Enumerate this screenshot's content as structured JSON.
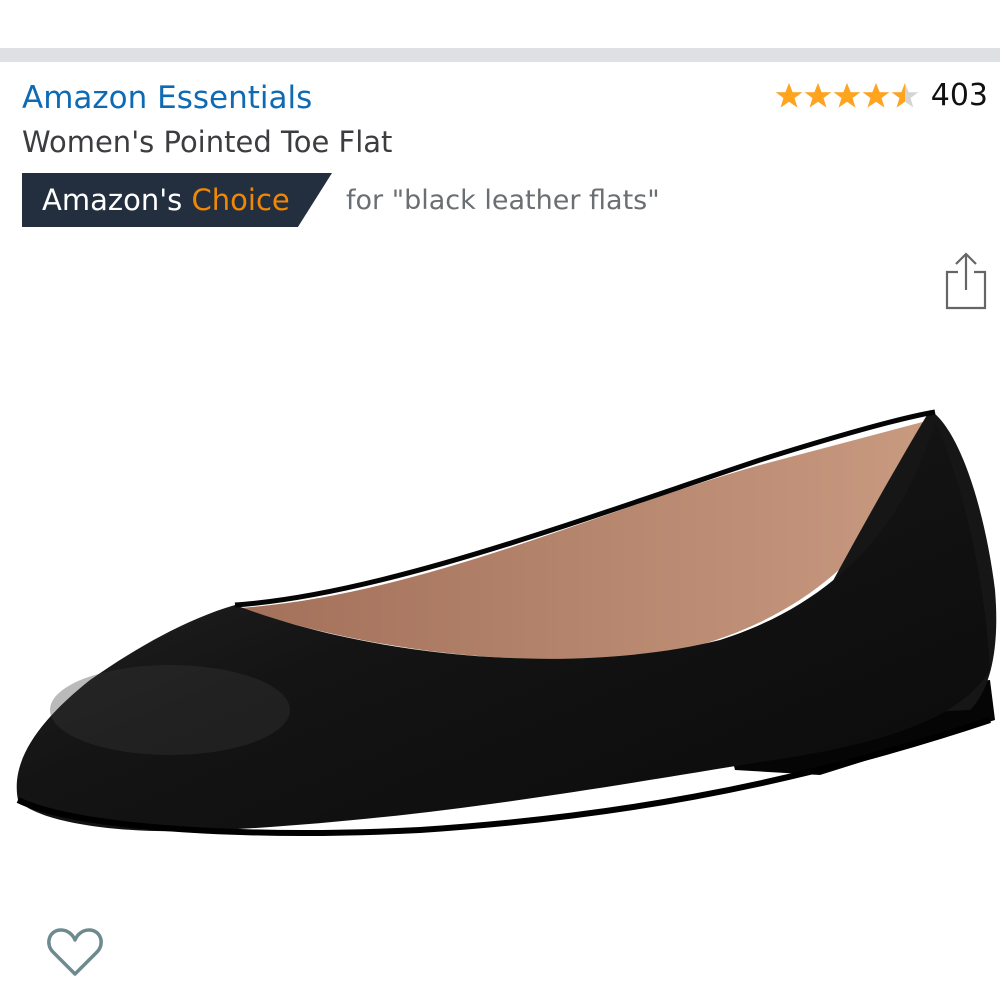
{
  "product": {
    "brand": "Amazon Essentials",
    "title": "Women's Pointed Toe Flat",
    "rating": 4.5,
    "review_count": "403"
  },
  "badge": {
    "prefix": "Amazon's",
    "highlight": "Choice",
    "for_text": "for \"black leather flats\""
  },
  "icons": {
    "share": "share-icon",
    "wishlist": "heart-icon",
    "star": "star-icon"
  },
  "colors": {
    "brand_link": "#0f6ab4",
    "star": "#ffa41c",
    "badge_bg": "#232f3e",
    "badge_highlight": "#f08804"
  }
}
